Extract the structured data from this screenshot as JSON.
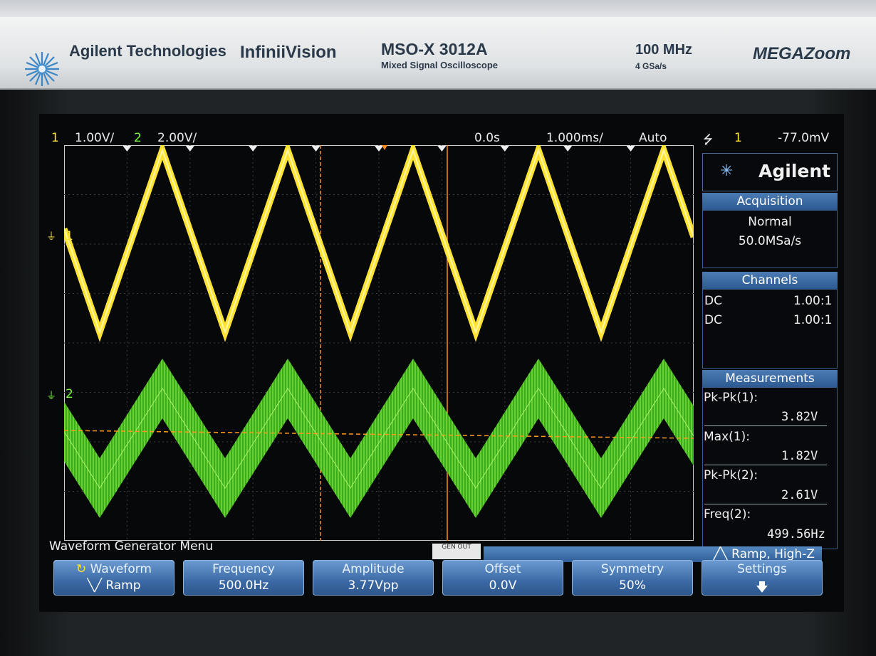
{
  "brand": {
    "company": "Agilent Technologies",
    "product": "InfiniiVision",
    "model": "MSO-X 3012A",
    "model_desc": "Mixed Signal Oscilloscope",
    "bandwidth": "100 MHz",
    "sample_rate": "4 GSa/s",
    "zoom_logo": "MEGAZoom"
  },
  "status_bar": {
    "ch1_num": "1",
    "ch1_scale": "1.00V/",
    "ch2_num": "2",
    "ch2_scale": "2.00V/",
    "time_offset": "0.0s",
    "time_scale": "1.000ms/",
    "trigger_mode": "Auto",
    "trigger_source": "1",
    "trigger_level": "-77.0mV"
  },
  "markers": {
    "ch1_ground": "1",
    "ch2_ground": "2"
  },
  "side_panel": {
    "logo": "Agilent",
    "acquisition": {
      "title": "Acquisition",
      "mode": "Normal",
      "rate": "50.0MSa/s"
    },
    "channels": {
      "title": "Channels",
      "rows": [
        {
          "coupling": "DC",
          "probe": "1.00:1"
        },
        {
          "coupling": "DC",
          "probe": "1.00:1"
        }
      ]
    },
    "measurements": {
      "title": "Measurements",
      "items": [
        {
          "label": "Pk-Pk(1):",
          "value": "3.82V"
        },
        {
          "label": "Max(1):",
          "value": "1.82V"
        },
        {
          "label": "Pk-Pk(2):",
          "value": "2.61V"
        },
        {
          "label": "Freq(2):",
          "value": "499.56Hz"
        }
      ]
    }
  },
  "menu": {
    "title": "Waveform Generator Menu",
    "gen_out": "GEN OUT",
    "strip": "Ramp, High-Z",
    "softkeys": [
      {
        "label": "Waveform",
        "value": "Ramp"
      },
      {
        "label": "Frequency",
        "value": "500.0Hz"
      },
      {
        "label": "Amplitude",
        "value": "3.77Vpp"
      },
      {
        "label": "Offset",
        "value": "0.0V"
      },
      {
        "label": "Symmetry",
        "value": "50%"
      },
      {
        "label": "Settings",
        "value": ""
      }
    ]
  },
  "colors": {
    "ch1": "#ffe433",
    "ch2": "#7cff3a",
    "accent": "#3c6aa6",
    "cursor": "#ff9a1a"
  }
}
